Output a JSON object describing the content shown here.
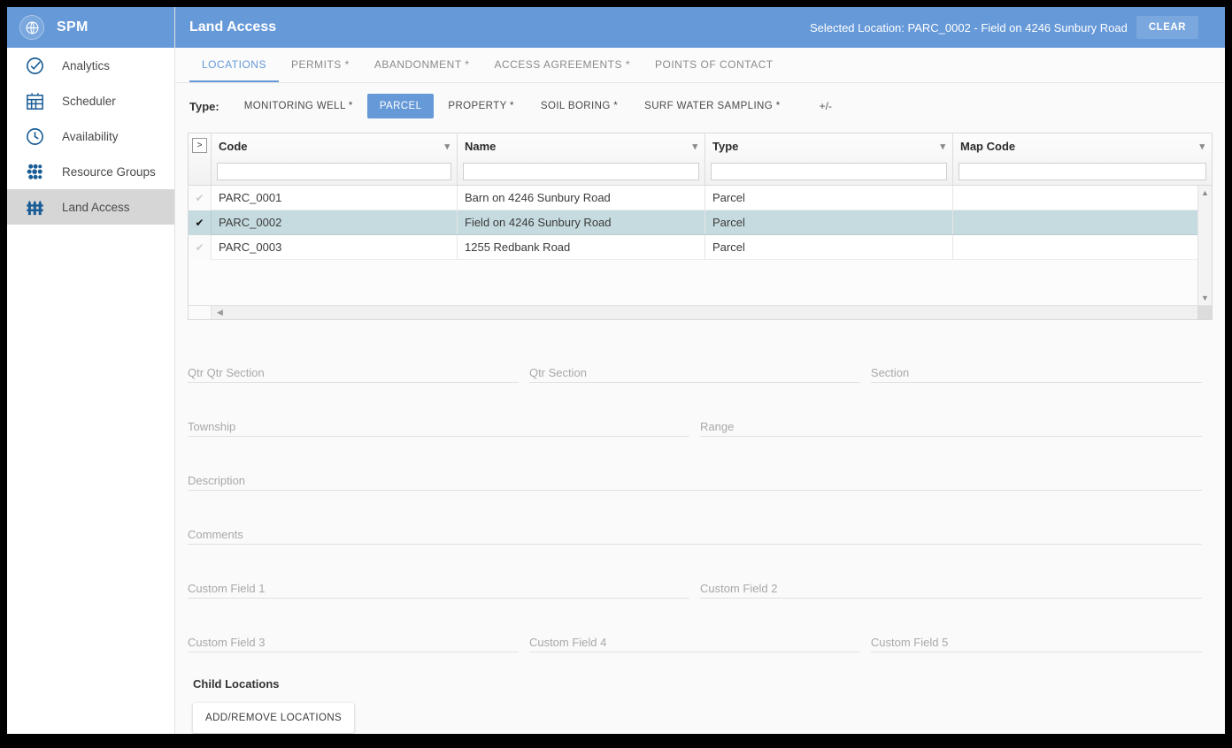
{
  "brand": {
    "name": "SPM",
    "logo_icon": "globe-icon"
  },
  "sidebar": {
    "items": [
      {
        "label": "Analytics",
        "icon": "check-circle-icon",
        "active": false
      },
      {
        "label": "Scheduler",
        "icon": "calendar-icon",
        "active": false
      },
      {
        "label": "Availability",
        "icon": "clock-icon",
        "active": false
      },
      {
        "label": "Resource Groups",
        "icon": "resource-groups-icon",
        "active": false
      },
      {
        "label": "Land Access",
        "icon": "fence-icon",
        "active": true
      }
    ]
  },
  "header": {
    "title": "Land Access",
    "selected_location": "Selected Location: PARC_0002 - Field on 4246 Sunbury Road",
    "clear_label": "CLEAR",
    "bg_color": "#6699d8"
  },
  "tabs": [
    {
      "label": "LOCATIONS",
      "active": true
    },
    {
      "label": "PERMITS *",
      "active": false
    },
    {
      "label": "ABANDONMENT *",
      "active": false
    },
    {
      "label": "ACCESS AGREEMENTS *",
      "active": false
    },
    {
      "label": "POINTS OF CONTACT",
      "active": false
    }
  ],
  "type_bar": {
    "label": "Type:",
    "buttons": [
      {
        "label": "MONITORING WELL *",
        "active": false
      },
      {
        "label": "PARCEL",
        "active": true
      },
      {
        "label": "PROPERTY *",
        "active": false
      },
      {
        "label": "SOIL BORING *",
        "active": false
      },
      {
        "label": "SURF WATER SAMPLING *",
        "active": false
      }
    ],
    "plus_minus": "+/-"
  },
  "grid": {
    "expand_button": ">",
    "columns": [
      {
        "header": "Code",
        "filter_value": "",
        "caret": "chevron-down-icon"
      },
      {
        "header": "Name",
        "filter_value": "",
        "caret": "chevron-down-icon"
      },
      {
        "header": "Type",
        "filter_value": "",
        "caret": "chevron-down-icon"
      },
      {
        "header": "Map Code",
        "filter_value": "",
        "caret": "chevron-down-icon"
      }
    ],
    "rows": [
      {
        "code": "PARC_0001",
        "name": "Barn on 4246 Sunbury Road",
        "type": "Parcel",
        "map_code": "",
        "selected": false
      },
      {
        "code": "PARC_0002",
        "name": "Field on 4246 Sunbury Road",
        "type": "Parcel",
        "map_code": "",
        "selected": true
      },
      {
        "code": "PARC_0003",
        "name": "1255 Redbank Road",
        "type": "Parcel",
        "map_code": "",
        "selected": false
      }
    ],
    "selected_row_color": "#c6dbe0",
    "check_glyph": "✔",
    "scroll_up": "▲",
    "scroll_down": "▼",
    "scroll_left": "◀",
    "scroll_right": "▶"
  },
  "form": {
    "fields": {
      "qtr_qtr_section": {
        "label": "Qtr Qtr Section",
        "value": ""
      },
      "qtr_section": {
        "label": "Qtr Section",
        "value": ""
      },
      "section": {
        "label": "Section",
        "value": ""
      },
      "township": {
        "label": "Township",
        "value": ""
      },
      "range": {
        "label": "Range",
        "value": ""
      },
      "description": {
        "label": "Description",
        "value": ""
      },
      "comments": {
        "label": "Comments",
        "value": ""
      },
      "custom_field_1": {
        "label": "Custom Field 1",
        "value": ""
      },
      "custom_field_2": {
        "label": "Custom Field 2",
        "value": ""
      },
      "custom_field_3": {
        "label": "Custom Field 3",
        "value": ""
      },
      "custom_field_4": {
        "label": "Custom Field 4",
        "value": ""
      },
      "custom_field_5": {
        "label": "Custom Field 5",
        "value": ""
      }
    },
    "child_locations_title": "Child Locations",
    "add_remove_label": "ADD/REMOVE LOCATIONS"
  }
}
